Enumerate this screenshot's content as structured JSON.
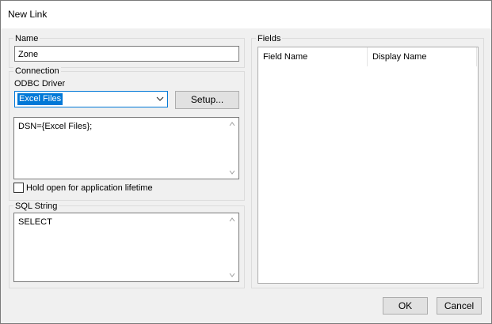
{
  "window": {
    "title": "New Link"
  },
  "name_group": {
    "legend": "Name",
    "value": "Zone"
  },
  "connection_group": {
    "legend": "Connection",
    "odbc_label": "ODBC Driver",
    "odbc_selected": "Excel Files",
    "setup_button": "Setup...",
    "connection_string": "DSN={Excel Files};",
    "hold_open_label": "Hold open for application lifetime",
    "hold_open_checked": false
  },
  "sql_group": {
    "legend": "SQL String",
    "value": "SELECT"
  },
  "fields_group": {
    "legend": "Fields",
    "columns": [
      "Field Name",
      "Display Name"
    ],
    "rows": []
  },
  "buttons": {
    "ok": "OK",
    "cancel": "Cancel"
  },
  "icons": {
    "dropdown": "chevron-down-icon",
    "scroll_up": "scroll-up-icon",
    "scroll_down": "scroll-down-icon"
  }
}
